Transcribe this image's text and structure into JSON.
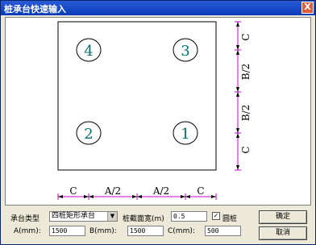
{
  "window": {
    "title": "桩承台快速输入",
    "close_glyph": "X"
  },
  "piles": {
    "p1": "1",
    "p2": "2",
    "p3": "3",
    "p4": "4"
  },
  "dims": {
    "c": "C",
    "b2": "B/2",
    "a2": "A/2"
  },
  "form": {
    "type_label": "承台类型",
    "type_value": "四桩矩形承台",
    "width_label": "桩截面宽(m)",
    "width_value": "0.5",
    "round_label": "圆桩",
    "round_checked": true,
    "a_label": "A(mm):",
    "a_value": "1500",
    "b_label": "B(mm):",
    "b_value": "1500",
    "c_label": "C(mm):",
    "c_value": "500"
  },
  "buttons": {
    "ok": "确定",
    "cancel": "取消"
  },
  "colors": {
    "pile_text": "#007070",
    "dim_line": "#cc00cc",
    "outline": "#000000"
  }
}
